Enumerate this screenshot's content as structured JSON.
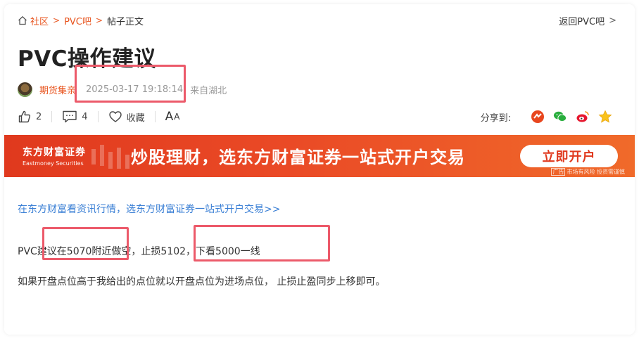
{
  "breadcrumb": {
    "items": [
      "社区",
      "PVC吧"
    ],
    "current": "帖子正文"
  },
  "back_link": "返回PVC吧",
  "post": {
    "title": "PVC操作建议",
    "author": "期货集亲",
    "date": "2025-03-17 19:18:14",
    "location": "来自湖北"
  },
  "actions": {
    "likes": "2",
    "comments": "4",
    "favorite_label": "收藏",
    "font_big": "A",
    "font_small": "A",
    "share_label": "分享到:"
  },
  "banner": {
    "brand_cn": "东方财富证券",
    "brand_en": "Eastmoney Securities",
    "slogan": "炒股理财，选东方财富证券一站式开户交易",
    "cta": "立即开户",
    "ad_tag": "广告",
    "ad_note": "市场有风险 投资需谨慎"
  },
  "content": {
    "promo_link": "在东方财富看资讯行情，选东方财富证券一站式开户交易>>",
    "paragraph1": "PVC建议在5070附近做空，止损5102，下看5000一线",
    "paragraph2": "如果开盘点位高于我给出的点位就以开盘点位为进场点位， 止损止盈同步上移即可。"
  },
  "colors": {
    "accent": "#e8541e",
    "link": "#3a7fd5",
    "highlight": "#ec5a6a",
    "banner": "#e0391e"
  }
}
